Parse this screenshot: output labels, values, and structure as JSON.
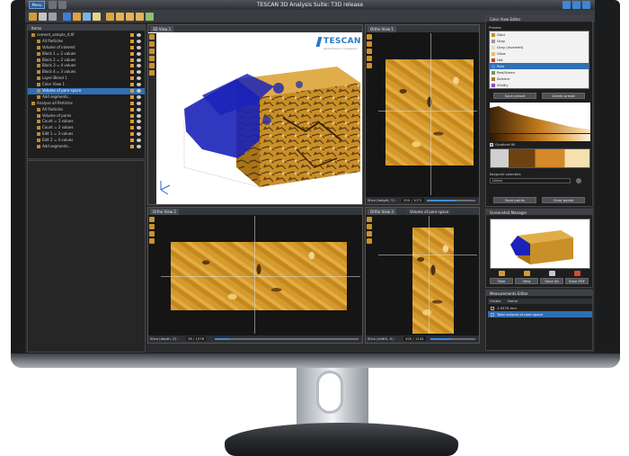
{
  "app": {
    "title": "TESCAN 3D Analysis Suite: T3D release",
    "menu_label": "Menu"
  },
  "tree_panel": {
    "header": "Items",
    "rows": [
      {
        "label": "cement_sample_4.tif"
      },
      {
        "label": "All Particles"
      },
      {
        "label": "Volume of interest"
      },
      {
        "label": "Block 1 = 2 values"
      },
      {
        "label": "Block 2 = 2 values"
      },
      {
        "label": "Block 3 = 4 values"
      },
      {
        "label": "Block 4 = 3 values"
      },
      {
        "label": "Layer Blend 1"
      },
      {
        "label": "Color View 1"
      },
      {
        "label": "Volume of pore space"
      },
      {
        "label": "Add segments..."
      },
      {
        "label": "Analyse all Particles"
      },
      {
        "label": "All Particles"
      },
      {
        "label": "Volume of pores"
      },
      {
        "label": "Count = 3 values"
      },
      {
        "label": "Count = 2 values"
      },
      {
        "label": "Edit 1 = 3 values"
      },
      {
        "label": "Edit 2 = 4 values"
      },
      {
        "label": "Add segments..."
      }
    ]
  },
  "views": {
    "view3d_tab": "3D View 1",
    "logo_text": "TESCAN",
    "logo_sub": "performance in nanospace",
    "ortho1_tab": "Ortho View 1",
    "ortho1_slice_label": "Slice (height, Y) :",
    "ortho1_slice_count": "550 / 1071",
    "ortho2_tab": "Ortho View 2",
    "ortho2_slice_label": "Slice (depth, Z) :",
    "ortho2_slice_count": "36 / 1076",
    "ortho3_tab": "Ortho View 3",
    "ortho3_tab2": "Volume of pore space",
    "ortho3_slice_label": "Slice (width, X) :",
    "ortho3_slice_count": "450 / 1145",
    "slider_positions": {
      "ortho1": 0.6,
      "ortho2": 0.1,
      "ortho3": 0.45
    }
  },
  "color_editor": {
    "header": "Color View Editor",
    "presets_label": "Presets",
    "presets": [
      {
        "label": "Gold"
      },
      {
        "label": "Gray"
      },
      {
        "label": "Gray (inverted)"
      },
      {
        "label": "Glow"
      },
      {
        "label": "Hot"
      },
      {
        "label": "Rain"
      },
      {
        "label": "Red/Green"
      },
      {
        "label": "Seismic"
      },
      {
        "label": "Vividly"
      }
    ],
    "selected_preset_index": 5,
    "save_preset_label": "Save preset",
    "delete_preset_label": "Delete preset",
    "gradient_checkbox": "Gradient fill",
    "keypoint_label": "Keypoint selected:",
    "keypoint_value": "Linear",
    "save_points_label": "Save points",
    "clear_points_label": "Clear points"
  },
  "screenshot_manager": {
    "header": "Screenshot Manager",
    "buttons": [
      {
        "label": "Take"
      },
      {
        "label": "View"
      },
      {
        "label": "Save All"
      },
      {
        "label": "Save PDF"
      }
    ]
  },
  "measurements": {
    "header": "Measurements Editor",
    "col_visible": "Visible",
    "col_name": "Name",
    "rows": [
      {
        "label": "1.0570 mm"
      },
      {
        "label": "Total volume of pore space"
      }
    ]
  },
  "colors": {
    "accent_blue": "#2f6fb5",
    "rock_gold": "#d59a2c",
    "pore_blue": "#1a22b8",
    "tescan_blue": "#2a79c4"
  }
}
